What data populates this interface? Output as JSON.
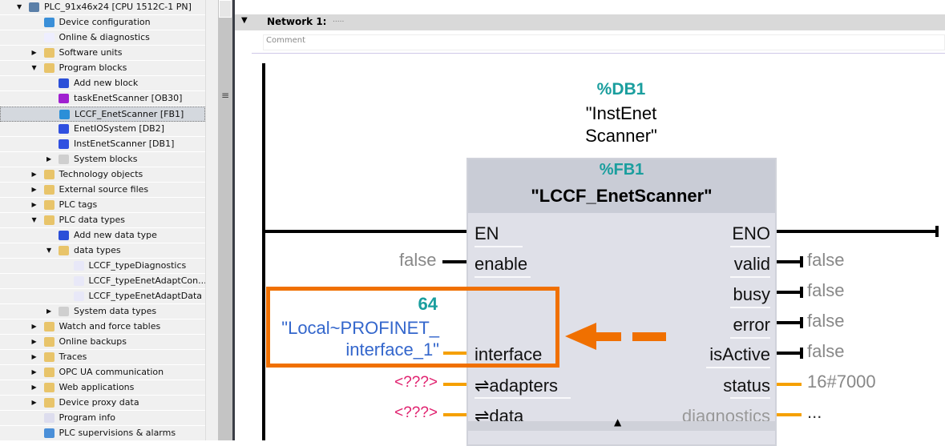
{
  "tree": {
    "items": [
      {
        "label": "PLC_91x46x24 [CPU 1512C-1 PN]",
        "level": 0,
        "expanded": true,
        "icon": "plc-icon"
      },
      {
        "label": "Device configuration",
        "level": 1,
        "icon": "device-config-icon"
      },
      {
        "label": "Online & diagnostics",
        "level": 1,
        "icon": "online-diagnostics-icon"
      },
      {
        "label": "Software units",
        "level": 1,
        "expanded": false,
        "icon": "folder-icon"
      },
      {
        "label": "Program blocks",
        "level": 1,
        "expanded": true,
        "icon": "folder-icon"
      },
      {
        "label": "Add new block",
        "level": 2,
        "icon": "add-new-icon"
      },
      {
        "label": "taskEnetScanner [OB30]",
        "level": 2,
        "icon": "ob-icon"
      },
      {
        "label": "LCCF_EnetScanner [FB1]",
        "level": 2,
        "icon": "fb-icon",
        "selected": true
      },
      {
        "label": "EnetIOSystem [DB2]",
        "level": 2,
        "icon": "db-icon"
      },
      {
        "label": "InstEnetScanner [DB1]",
        "level": 2,
        "icon": "db-icon"
      },
      {
        "label": "System blocks",
        "level": 2,
        "expanded": false,
        "icon": "folder-gray-icon"
      },
      {
        "label": "Technology objects",
        "level": 1,
        "expanded": false,
        "icon": "folder-icon"
      },
      {
        "label": "External source files",
        "level": 1,
        "expanded": false,
        "icon": "folder-icon"
      },
      {
        "label": "PLC tags",
        "level": 1,
        "expanded": false,
        "icon": "folder-icon"
      },
      {
        "label": "PLC data types",
        "level": 1,
        "expanded": true,
        "icon": "folder-icon"
      },
      {
        "label": "Add new data type",
        "level": 2,
        "icon": "add-new-icon"
      },
      {
        "label": "data types",
        "level": 2,
        "expanded": true,
        "icon": "folder-icon"
      },
      {
        "label": "LCCF_typeDiagnostics",
        "level": 3,
        "icon": "udt-icon"
      },
      {
        "label": "LCCF_typeEnetAdaptCon...",
        "level": 3,
        "icon": "udt-icon"
      },
      {
        "label": "LCCF_typeEnetAdaptData",
        "level": 3,
        "icon": "udt-icon"
      },
      {
        "label": "System data types",
        "level": 2,
        "expanded": false,
        "icon": "folder-gray-icon"
      },
      {
        "label": "Watch and force tables",
        "level": 1,
        "expanded": false,
        "icon": "folder-icon"
      },
      {
        "label": "Online backups",
        "level": 1,
        "expanded": false,
        "icon": "folder-icon"
      },
      {
        "label": "Traces",
        "level": 1,
        "expanded": false,
        "icon": "folder-icon"
      },
      {
        "label": "OPC UA communication",
        "level": 1,
        "expanded": false,
        "icon": "folder-icon"
      },
      {
        "label": "Web applications",
        "level": 1,
        "expanded": false,
        "icon": "folder-icon"
      },
      {
        "label": "Device proxy data",
        "level": 1,
        "expanded": false,
        "icon": "folder-icon"
      },
      {
        "label": "Program info",
        "level": 1,
        "icon": "program-info-icon"
      },
      {
        "label": "PLC supervisions & alarms",
        "level": 1,
        "icon": "alarms-icon"
      }
    ]
  },
  "network": {
    "title": "Network 1:",
    "dots": ".....",
    "comment_placeholder": "Comment"
  },
  "instance": {
    "address": "%DB1",
    "name_line1": "\"InstEnet",
    "name_line2": "Scanner\""
  },
  "block": {
    "address": "%FB1",
    "name": "\"LCCF_EnetScanner\"",
    "inputs": {
      "en": "EN",
      "enable": "enable",
      "interface": "interface",
      "adapters": "⇌adapters",
      "data": "⇌data"
    },
    "outputs": {
      "eno": "ENO",
      "valid": "valid",
      "busy": "busy",
      "error": "error",
      "isActive": "isActive",
      "status": "status",
      "diagnostics": "diagnostics"
    }
  },
  "actuals": {
    "enable": "false",
    "interface_value": "64",
    "interface_name1": "\"Local~PROFINET_",
    "interface_name2": "interface_1\"",
    "adapters": "<???>",
    "data": "<???>",
    "valid": "false",
    "busy": "false",
    "error": "false",
    "isActive": "false",
    "status": "16#7000",
    "diagnostics": "..."
  },
  "colors": {
    "teal": "#1a9e9e",
    "highlight": "#f07000",
    "wire_orange": "#f5a000",
    "unassigned": "#e0206e",
    "tag_blue": "#3366cc"
  }
}
